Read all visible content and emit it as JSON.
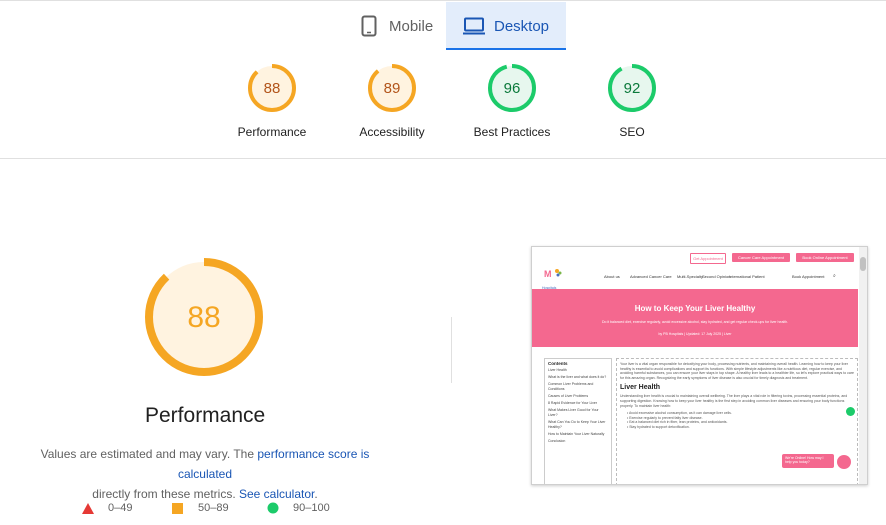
{
  "tabs": [
    {
      "label": "Mobile",
      "icon": "phone-icon",
      "selected": false
    },
    {
      "label": "Desktop",
      "icon": "monitor-icon",
      "selected": true
    }
  ],
  "scores": [
    {
      "value": "88",
      "label": "Performance",
      "score": 88,
      "color": "#f5a623",
      "text_color": "#b2541a",
      "bg": "#fff3e0"
    },
    {
      "value": "89",
      "label": "Accessibility",
      "score": 89,
      "color": "#f5a623",
      "text_color": "#b2541a",
      "bg": "#fff3e0"
    },
    {
      "value": "96",
      "label": "Best Practices",
      "score": 96,
      "color": "#1ccb6a",
      "text_color": "#0b7a3b",
      "bg": "#e7f7ee"
    },
    {
      "value": "92",
      "label": "SEO",
      "score": 92,
      "color": "#1ccb6a",
      "text_color": "#0b7a3b",
      "bg": "#e7f7ee"
    }
  ],
  "main": {
    "score": "88",
    "score_value": 88,
    "title": "Performance",
    "desc_prefix": "Values are estimated and may vary. The ",
    "desc_link1": "performance score is calculated",
    "desc_middle": "directly from these metrics. ",
    "desc_link2": "See calculator",
    "desc_suffix": "."
  },
  "legend": [
    {
      "range": "0–49",
      "shape": "triangle",
      "color": "#e53935"
    },
    {
      "range": "50–89",
      "shape": "square",
      "color": "#f5a623"
    },
    {
      "range": "90–100",
      "shape": "circle",
      "color": "#1ccb6a"
    }
  ],
  "screenshot": {
    "top_buttons": [
      "Get Appointment",
      "Cancer Care Appointment",
      "Book Online Appointment"
    ],
    "logo_text": "Hospitals",
    "nav": [
      "About us",
      "Advanced Cancer Care",
      "Multi-Specialty",
      "Second Opinion",
      "International Patient",
      "Book Appointment"
    ],
    "hero_title": "How to Keep Your Liver Healthy",
    "hero_sub": "Do it balanced diet, exercise regularly, avoid excessive alcohol, stay hydrated, and get regular check-ups for liver health.",
    "hero_meta": "by PB Hospitals  |  Updated: 17 July 2025  |  Liver",
    "toc_title": "Contents",
    "toc_items": [
      "Liver Health",
      "What is the liver and what does it do?",
      "Common Liver Problems and Conditions",
      "Causes of Liver Problems",
      "8 Rapid Evidence for Your Liver",
      "What Makes Liver Good for Your Liver?",
      "What Can You Do to Keep Your Liver Healthy?",
      "How to Maintain Your Liver Naturally",
      "Conclusion"
    ],
    "intro": "Your liver is a vital organ responsible for detoxifying your body, processing nutrients, and maintaining overall health. Learning how to keep your liver healthy is essential to avoid complications and support its functions. With simple lifestyle adjustments like a nutritious diet, regular exercise, and avoiding harmful substances, you can ensure your liver stays in top shape. A healthy liver leads to a healthier life, so let's explore practical ways to care for this amazing organ. Recognizing the early symptoms of liver disease is also crucial for timely diagnosis and treatment.",
    "section_title": "Liver Health",
    "section_text": "Understanding liver health is crucial to maintaining overall wellbeing. The liver plays a vital role in filtering toxins, processing essential proteins, and supporting digestion. Knowing how to keep your liver healthy is the first step in avoiding common liver diseases and ensuring your body functions properly. To maintain liver health:",
    "bullets": [
      "Avoid excessive alcohol consumption, as it can damage liver cells.",
      "Exercise regularly to prevent fatty liver disease.",
      "Eat a balanced diet rich in fiber, lean proteins, and antioxidants.",
      "Stay hydrated to support detoxification."
    ],
    "chat_text": "We're Online! How may I help you today?"
  }
}
